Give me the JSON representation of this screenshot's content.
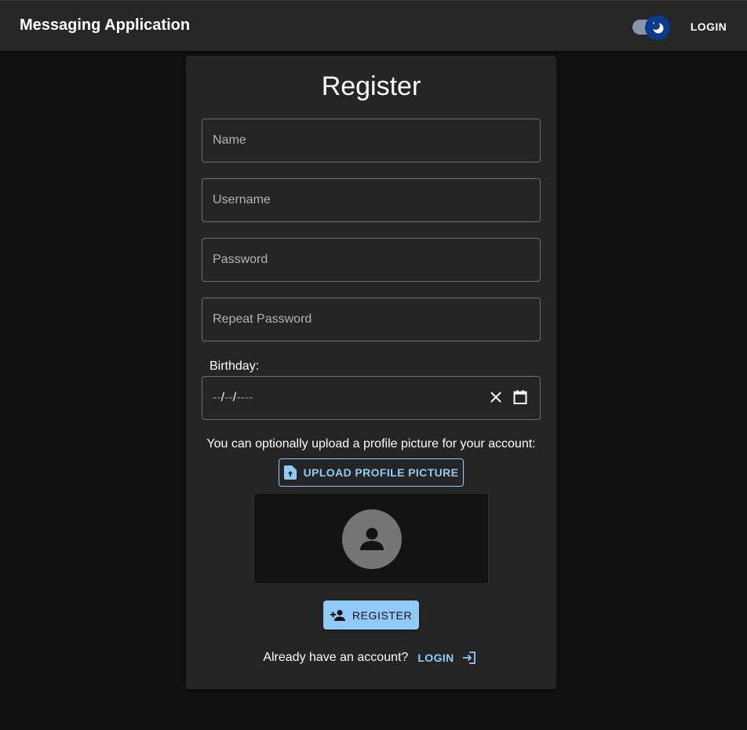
{
  "appbar": {
    "title": "Messaging Application",
    "login_label": "LOGIN",
    "theme_toggle_icon": "moon-icon"
  },
  "register": {
    "title": "Register",
    "fields": {
      "name_placeholder": "Name",
      "username_placeholder": "Username",
      "password_placeholder": "Password",
      "repeat_password_placeholder": "Repeat Password"
    },
    "birthday": {
      "label": "Birthday:",
      "month": "--",
      "day": "--",
      "year": "----",
      "separator": "/"
    },
    "upload_note": "You can optionally upload a profile picture for your account:",
    "upload_button_label": "UPLOAD PROFILE PICTURE",
    "register_button_label": "REGISTER",
    "already_text": "Already have an account?",
    "login_link_label": "LOGIN"
  },
  "colors": {
    "accent": "#90caf9",
    "background": "#121212",
    "appbar": "#272727",
    "card": "#252525"
  }
}
